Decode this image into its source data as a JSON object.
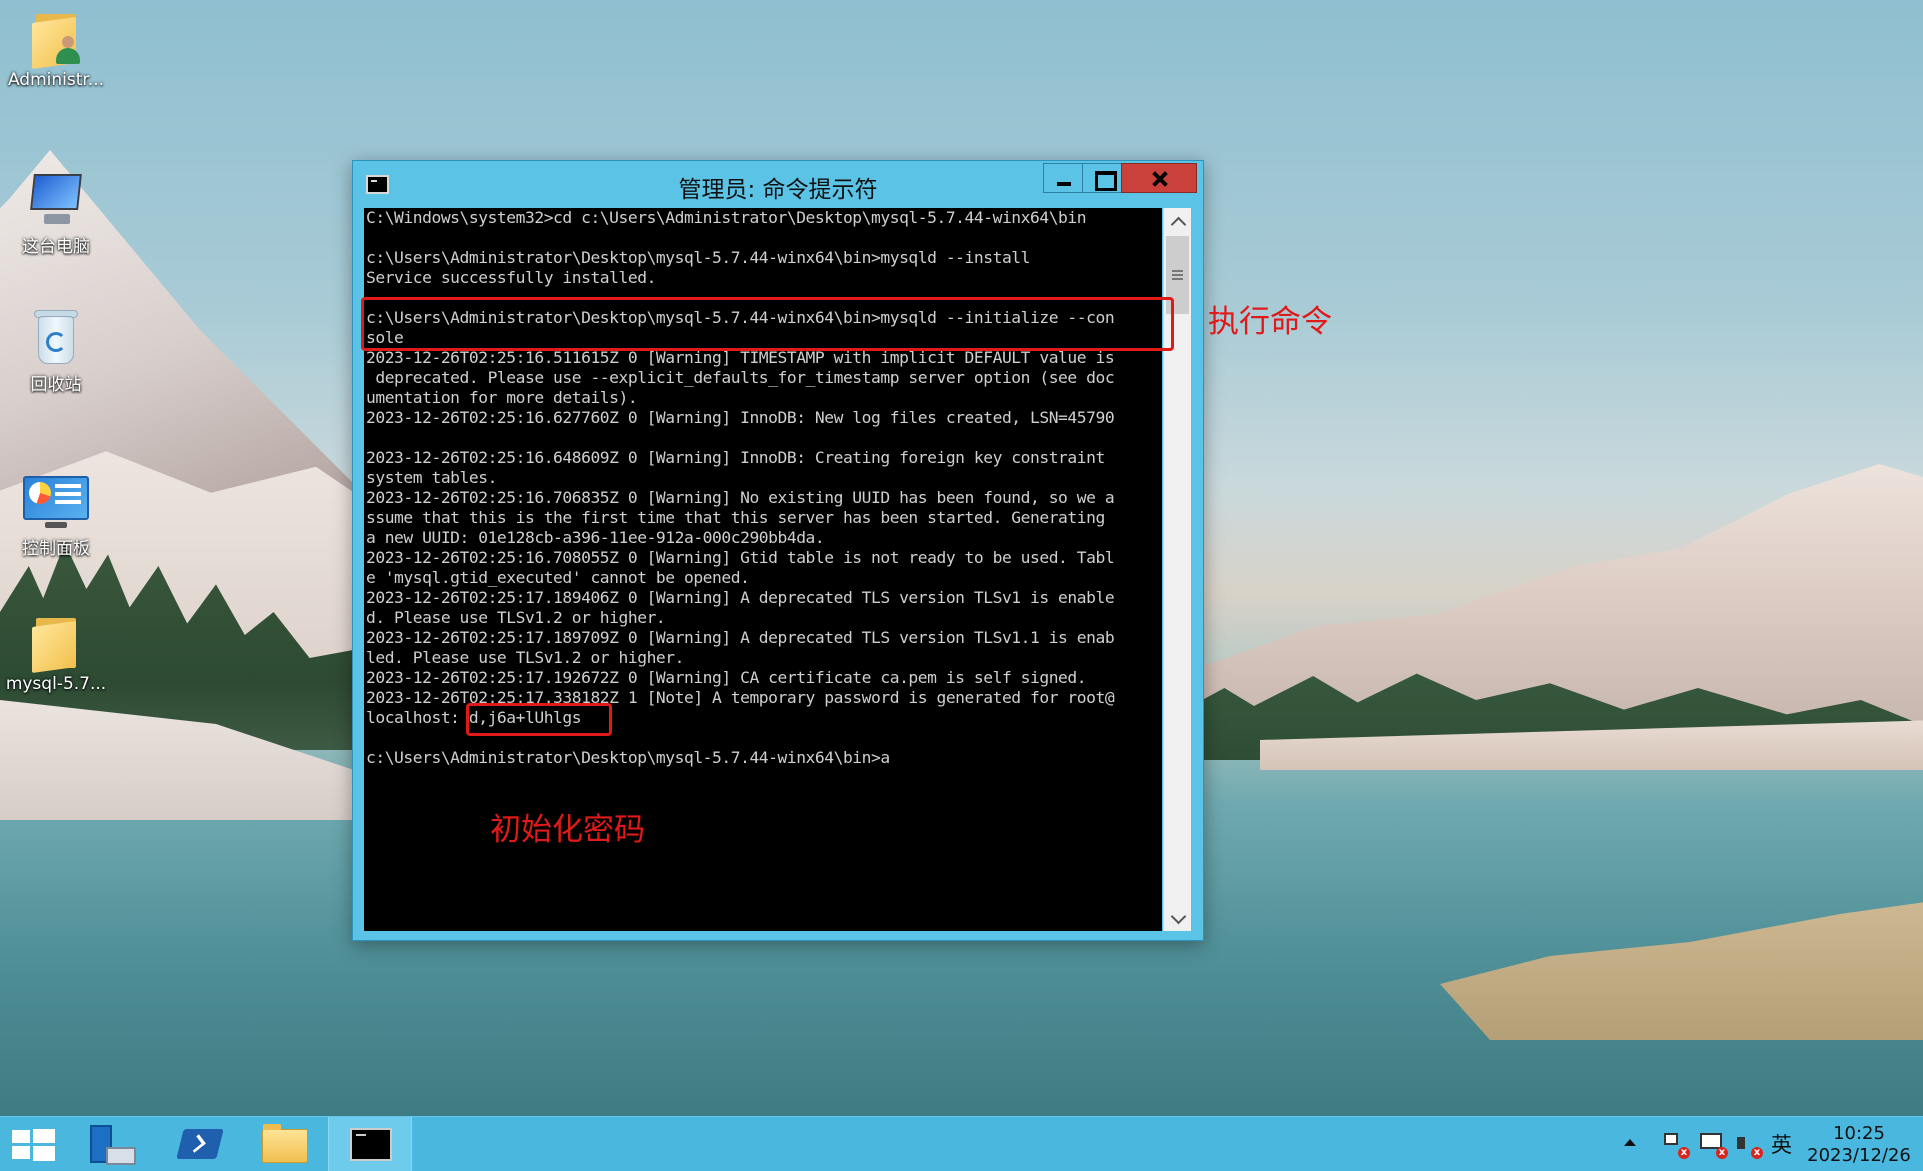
{
  "desktop": {
    "icons": [
      {
        "label": "Administr..."
      },
      {
        "label": "这台电脑"
      },
      {
        "label": "回收站"
      },
      {
        "label": "控制面板"
      },
      {
        "label": "mysql-5.7..."
      }
    ]
  },
  "window": {
    "title": "管理员: 命令提示符",
    "lines": [
      "C:\\Windows\\system32>cd c:\\Users\\Administrator\\Desktop\\mysql-5.7.44-winx64\\bin",
      "",
      "c:\\Users\\Administrator\\Desktop\\mysql-5.7.44-winx64\\bin>mysqld --install",
      "Service successfully installed.",
      "",
      "c:\\Users\\Administrator\\Desktop\\mysql-5.7.44-winx64\\bin>mysqld --initialize --con",
      "sole",
      "2023-12-26T02:25:16.511615Z 0 [Warning] TIMESTAMP with implicit DEFAULT value is",
      " deprecated. Please use --explicit_defaults_for_timestamp server option (see doc",
      "umentation for more details).",
      "2023-12-26T02:25:16.627760Z 0 [Warning] InnoDB: New log files created, LSN=45790",
      "",
      "2023-12-26T02:25:16.648609Z 0 [Warning] InnoDB: Creating foreign key constraint",
      "system tables.",
      "2023-12-26T02:25:16.706835Z 0 [Warning] No existing UUID has been found, so we a",
      "ssume that this is the first time that this server has been started. Generating",
      "a new UUID: 01e128cb-a396-11ee-912a-000c290bb4da.",
      "2023-12-26T02:25:16.708055Z 0 [Warning] Gtid table is not ready to be used. Tabl",
      "e 'mysql.gtid_executed' cannot be opened.",
      "2023-12-26T02:25:17.189406Z 0 [Warning] A deprecated TLS version TLSv1 is enable",
      "d. Please use TLSv1.2 or higher.",
      "2023-12-26T02:25:17.189709Z 0 [Warning] A deprecated TLS version TLSv1.1 is enab",
      "led. Please use TLSv1.2 or higher.",
      "2023-12-26T02:25:17.192672Z 0 [Warning] CA certificate ca.pem is self signed.",
      "2023-12-26T02:25:17.338182Z 1 [Note] A temporary password is generated for root@",
      "localhost: d,j6a+lUhlgs",
      "",
      "c:\\Users\\Administrator\\Desktop\\mysql-5.7.44-winx64\\bin>a"
    ]
  },
  "annotations": {
    "exec_label": "执行命令",
    "password_label": "初始化密码"
  },
  "taskbar": {
    "ime": "英",
    "time": "10:25",
    "date": "2023/12/26"
  },
  "colors": {
    "accent": "#5bc3e6",
    "taskbar": "#4ab7de",
    "annotation_red": "#e01919",
    "close_button": "#c9413a"
  }
}
